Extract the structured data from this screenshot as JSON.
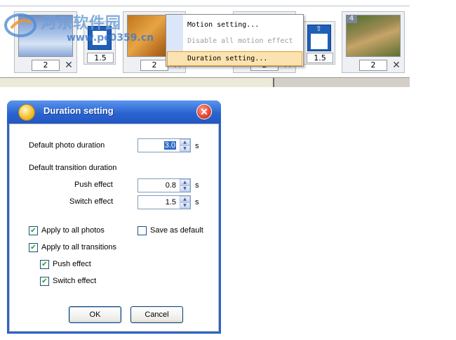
{
  "storyboard": {
    "photos": [
      {
        "duration": "2",
        "delete_glyph": "✕"
      },
      {
        "duration": "2",
        "delete_glyph": "✕"
      },
      {
        "duration": "2",
        "delete_glyph": "✕"
      },
      {
        "number": "4",
        "duration": "2",
        "delete_glyph": "✕"
      }
    ],
    "transitions": [
      {
        "duration": "1.5"
      },
      {
        "duration": "1.5"
      }
    ]
  },
  "context_menu": {
    "items": [
      {
        "label": "Motion setting...",
        "enabled": true
      },
      {
        "label": "Disable all motion effect",
        "enabled": false
      },
      {
        "label": "Duration setting...",
        "enabled": true,
        "highlighted": true
      }
    ]
  },
  "dialog": {
    "title": "Duration setting",
    "close_glyph": "✕",
    "default_photo_duration": {
      "label": "Default photo duration",
      "value": "3.0",
      "unit": "s"
    },
    "transition_section_label": "Default transition duration",
    "push_effect": {
      "label": "Push effect",
      "value": "0.8",
      "unit": "s"
    },
    "switch_effect": {
      "label": "Switch effect",
      "value": "1.5",
      "unit": "s"
    },
    "apply_all_photos": {
      "label": "Apply to all photos",
      "checked": true
    },
    "save_as_default": {
      "label": "Save as default",
      "checked": false
    },
    "apply_all_transitions": {
      "label": "Apply to all transitions",
      "checked": true
    },
    "apply_push": {
      "label": "Push effect",
      "checked": true
    },
    "apply_switch": {
      "label": "Switch effect",
      "checked": true
    },
    "ok_label": "OK",
    "cancel_label": "Cancel"
  },
  "glyphs": {
    "check": "✔",
    "spin_up": "▲",
    "spin_down": "▼"
  },
  "watermark": {
    "logo_icon": "watermark-logo-icon",
    "text_cn": "河东软件园",
    "url": "www.pc0359.cn"
  },
  "colors": {
    "title_bar": "#2a64d0",
    "menu_highlight": "#fbe3b1",
    "selection": "#316ac5",
    "check": "#21a121"
  }
}
